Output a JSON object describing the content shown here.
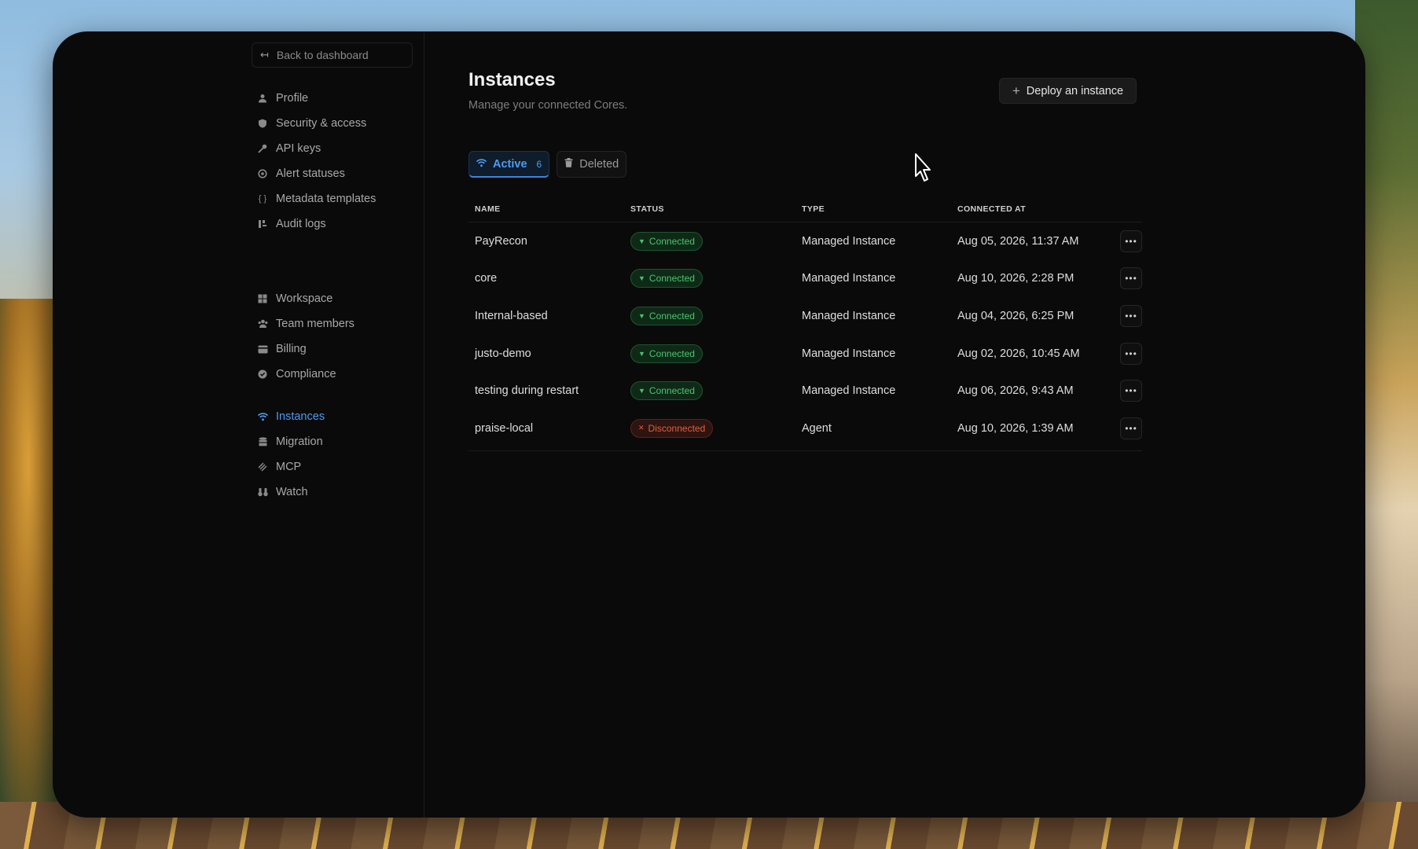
{
  "sidebar": {
    "back_label": "Back to dashboard",
    "groups": [
      {
        "items": [
          {
            "label": "Profile",
            "icon": "user-icon"
          },
          {
            "label": "Security & access",
            "icon": "shield-icon"
          },
          {
            "label": "API keys",
            "icon": "key-icon"
          },
          {
            "label": "Alert statuses",
            "icon": "alert-icon"
          },
          {
            "label": "Metadata templates",
            "icon": "braces-icon"
          },
          {
            "label": "Audit logs",
            "icon": "audit-icon"
          }
        ]
      },
      {
        "items": [
          {
            "label": "Workspace",
            "icon": "grid-icon"
          },
          {
            "label": "Team members",
            "icon": "team-icon"
          },
          {
            "label": "Billing",
            "icon": "card-icon"
          },
          {
            "label": "Compliance",
            "icon": "badge-check-icon"
          }
        ]
      },
      {
        "items": [
          {
            "label": "Instances",
            "icon": "wifi-icon",
            "active": true
          },
          {
            "label": "Migration",
            "icon": "database-icon"
          },
          {
            "label": "MCP",
            "icon": "mcp-icon"
          },
          {
            "label": "Watch",
            "icon": "binoculars-icon"
          }
        ]
      }
    ]
  },
  "page": {
    "title": "Instances",
    "subtitle": "Manage your connected Cores.",
    "deploy_label": "Deploy an instance"
  },
  "tabs": {
    "active_label": "Active",
    "active_count": "6",
    "deleted_label": "Deleted"
  },
  "table": {
    "headers": {
      "name": "NAME",
      "status": "STATUS",
      "type": "TYPE",
      "connected_at": "CONNECTED AT"
    },
    "rows": [
      {
        "name": "PayRecon",
        "status": "Connected",
        "type": "Managed Instance",
        "connected_at": "Aug 05, 2026, 11:37 AM"
      },
      {
        "name": "core",
        "status": "Connected",
        "type": "Managed Instance",
        "connected_at": "Aug 10, 2026, 2:28 PM"
      },
      {
        "name": "Internal-based",
        "status": "Connected",
        "type": "Managed Instance",
        "connected_at": "Aug 04, 2026, 6:25 PM"
      },
      {
        "name": "justo-demo",
        "status": "Connected",
        "type": "Managed Instance",
        "connected_at": "Aug 02, 2026, 10:45 AM"
      },
      {
        "name": "testing during restart",
        "status": "Connected",
        "type": "Managed Instance",
        "connected_at": "Aug 06, 2026, 9:43 AM"
      },
      {
        "name": "praise-local",
        "status": "Disconnected",
        "type": "Agent",
        "connected_at": "Aug 10, 2026, 1:39 AM"
      }
    ]
  },
  "colors": {
    "accent": "#4e9bf0",
    "connected": "#4ac46e",
    "disconnected": "#e0603e",
    "window_bg": "#0a0a0a"
  }
}
